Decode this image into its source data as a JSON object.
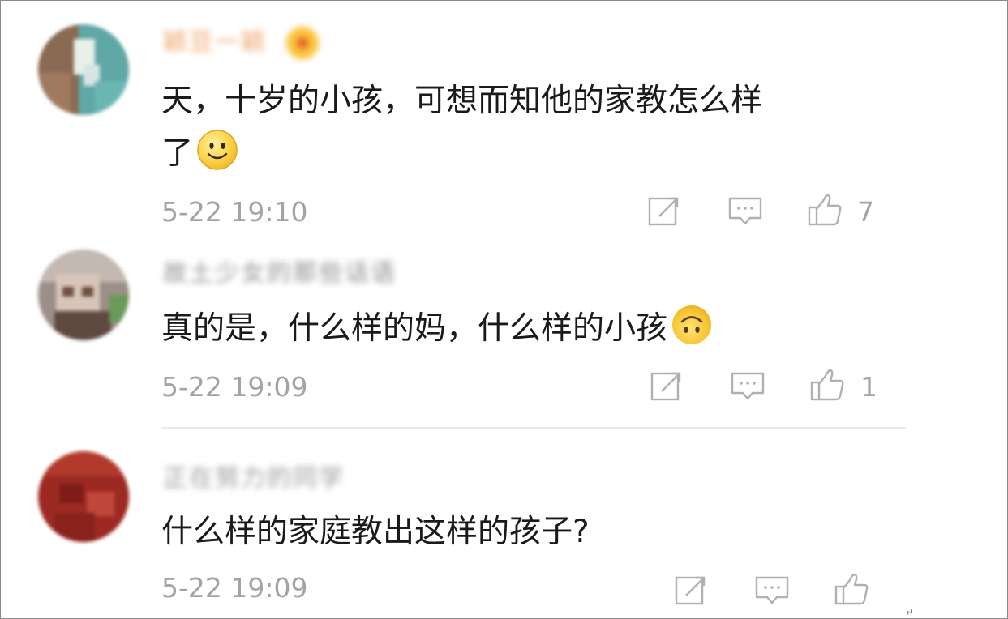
{
  "comments": [
    {
      "username": "颖豆一颖",
      "text_line1": "天，十岁的小孩，可想而知他的家教怎么样",
      "text_line2": "了",
      "emoji": "smile-emoji",
      "time": "5-22 19:10",
      "likes": "7"
    },
    {
      "username": "故土少女的那些话语",
      "text": "真的是，什么样的妈，什么样的小孩",
      "emoji": "upside-down-face-emoji",
      "time": "5-22 19:09",
      "likes": "1"
    },
    {
      "username": "正在努力的同学",
      "text": "什么样的家庭教出这样的孩子?",
      "time": "5-22 19:09"
    }
  ],
  "colors": {
    "text": "#1a1a1a",
    "meta": "#a3a3a3",
    "icon": "#b0b0b0",
    "divider": "#ececec"
  },
  "icons": {
    "share": "share-icon",
    "reply": "reply-icon",
    "like": "thumbs-up-icon"
  },
  "footer_mark": "↵"
}
